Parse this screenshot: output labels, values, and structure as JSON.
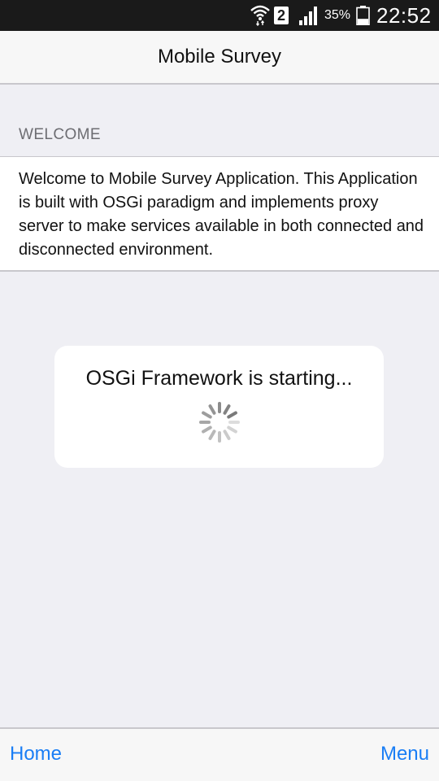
{
  "status_bar": {
    "sim_slot": "2",
    "battery_percent": "35%",
    "battery_level": 0.35,
    "time": "22:52",
    "icons": [
      "wifi-icon",
      "signal-icon",
      "battery-icon"
    ]
  },
  "nav": {
    "title": "Mobile Survey"
  },
  "welcome": {
    "section_header": "WELCOME",
    "text": "Welcome to Mobile Survey Application. This Application is built with OSGi paradigm and implements proxy server to make services available in both connected and disconnected environment."
  },
  "loading": {
    "message": "OSGi Framework is starting...",
    "icon": "spinner-icon"
  },
  "toolbar": {
    "home_label": "Home",
    "menu_label": "Menu"
  },
  "colors": {
    "status_bar_bg": "#1a1a1a",
    "page_bg": "#efeff4",
    "accent": "#1a7ef5",
    "section_header_text": "#6d6d72"
  }
}
